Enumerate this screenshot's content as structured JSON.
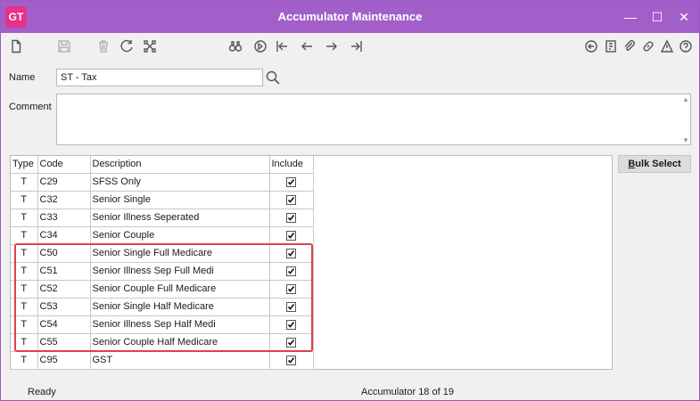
{
  "app": {
    "logo": "GT",
    "title": "Accumulator Maintenance"
  },
  "window_controls": {
    "minimize": "—",
    "maximize": "☐",
    "close": "✕"
  },
  "toolbar": {
    "left_icons": [
      "new-icon",
      "save-icon",
      "delete-icon",
      "refresh-icon",
      "hierarchy-icon"
    ],
    "nav_icons": [
      "find-icon",
      "goto-icon",
      "first-icon",
      "previous-icon",
      "next-icon",
      "last-icon"
    ],
    "right_icons": [
      "back-circle-icon",
      "notes-icon",
      "attach-icon",
      "link-icon",
      "alerts-icon",
      "help-icon"
    ]
  },
  "form": {
    "name_label": "Name",
    "name_value": "ST - Tax",
    "comment_label": "Comment",
    "comment_value": ""
  },
  "table": {
    "headers": {
      "type": "Type",
      "code": "Code",
      "description": "Description",
      "include": "Include"
    },
    "rows": [
      {
        "type": "T",
        "code": "C29",
        "description": "SFSS Only",
        "include": true
      },
      {
        "type": "T",
        "code": "C32",
        "description": "Senior Single",
        "include": true
      },
      {
        "type": "T",
        "code": "C33",
        "description": "Senior Illness Seperated",
        "include": true
      },
      {
        "type": "T",
        "code": "C34",
        "description": "Senior Couple",
        "include": true
      },
      {
        "type": "T",
        "code": "C50",
        "description": "Senior Single Full Medicare",
        "include": true
      },
      {
        "type": "T",
        "code": "C51",
        "description": "Senior Illness Sep Full Medi",
        "include": true
      },
      {
        "type": "T",
        "code": "C52",
        "description": "Senior Couple Full Medicare",
        "include": true
      },
      {
        "type": "T",
        "code": "C53",
        "description": "Senior Single Half Medicare",
        "include": true
      },
      {
        "type": "T",
        "code": "C54",
        "description": "Senior Illness Sep Half Medi",
        "include": true
      },
      {
        "type": "T",
        "code": "C55",
        "description": "Senior Couple Half Medicare",
        "include": true
      },
      {
        "type": "T",
        "code": "C95",
        "description": "GST",
        "include": true
      }
    ]
  },
  "bulk_select": {
    "label": "Bulk Select"
  },
  "status": {
    "left": "Ready",
    "center": "Accumulator 18 of 19"
  },
  "colors": {
    "titlebar": "#a25fc9",
    "logo": "#e8308c",
    "highlight": "#e0404a"
  }
}
